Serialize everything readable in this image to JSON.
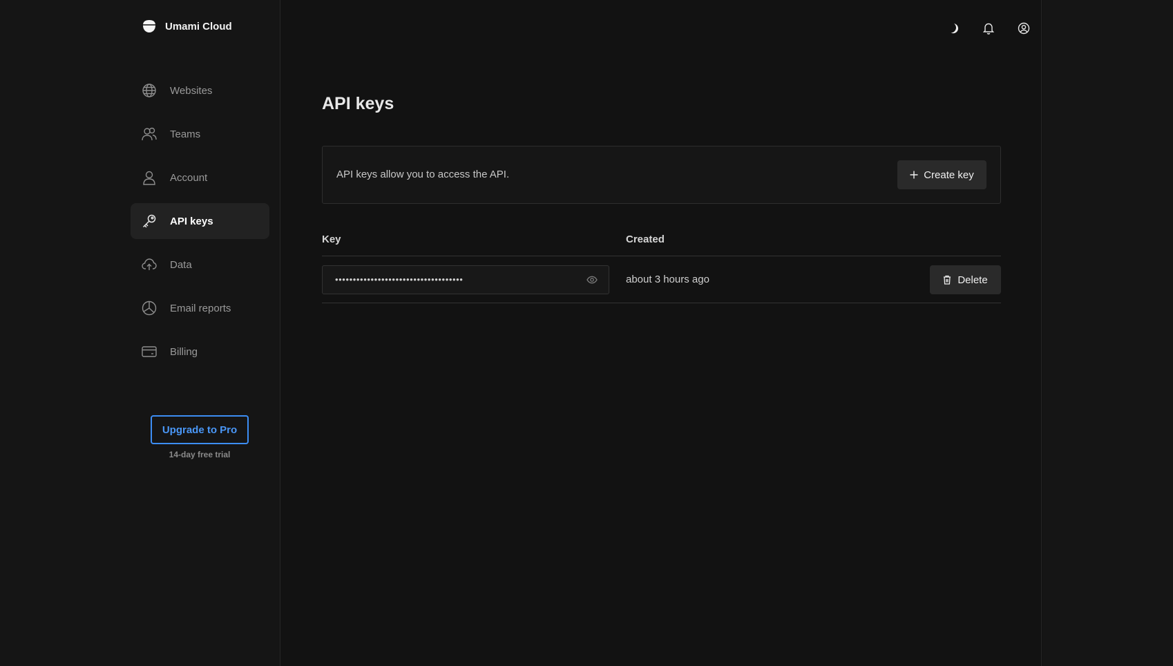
{
  "app": {
    "name": "Umami Cloud"
  },
  "sidebar": {
    "items": [
      {
        "label": "Websites",
        "icon": "globe-icon",
        "active": false
      },
      {
        "label": "Teams",
        "icon": "users-icon",
        "active": false
      },
      {
        "label": "Account",
        "icon": "user-icon",
        "active": false
      },
      {
        "label": "API keys",
        "icon": "key-icon",
        "active": true
      },
      {
        "label": "Data",
        "icon": "cloud-upload-icon",
        "active": false
      },
      {
        "label": "Email reports",
        "icon": "pie-chart-icon",
        "active": false
      },
      {
        "label": "Billing",
        "icon": "credit-card-icon",
        "active": false
      }
    ],
    "upgrade_label": "Upgrade to Pro",
    "trial_text": "14-day free trial"
  },
  "header": {
    "icons": [
      "moon-icon",
      "bell-icon",
      "user-circle-icon"
    ]
  },
  "page": {
    "title": "API keys",
    "info_text": "API keys allow you to access the API.",
    "create_label": "Create key"
  },
  "table": {
    "columns": [
      "Key",
      "Created"
    ],
    "rows": [
      {
        "key_masked": "••••••••••••••••••••••••••••••••••••",
        "created": "about 3 hours ago",
        "delete_label": "Delete"
      }
    ]
  },
  "colors": {
    "accent": "#3d8ef5",
    "background": "#121212",
    "sidebar": "#151515",
    "button": "#2a2a2a"
  }
}
